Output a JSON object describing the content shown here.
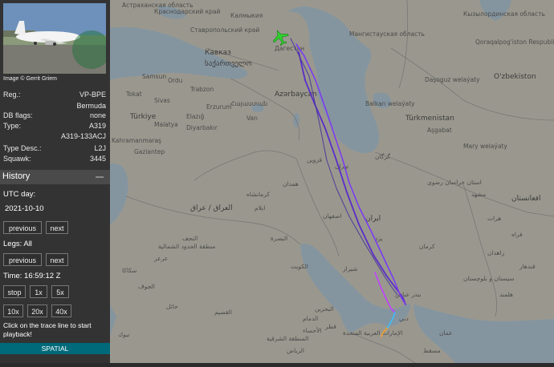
{
  "photo": {
    "credit": "Image © Gerrit Griem"
  },
  "aircraft": {
    "reg_label": "Reg.:",
    "reg_value": "VP-BPE",
    "country": "Bermuda",
    "db_flags_label": "DB flags:",
    "db_flags_value": "none",
    "type_label": "Type:",
    "type_value": "A319",
    "type_full": "A319-133ACJ",
    "type_desc_label": "Type Desc.:",
    "type_desc_value": "L2J",
    "squawk_label": "Squawk:",
    "squawk_value": "3445"
  },
  "history": {
    "title": "History",
    "utc_day_label": "UTC day:",
    "utc_day_value": "2021-10-10",
    "previous": "previous",
    "next": "next",
    "legs_label": "Legs: All",
    "legs_previous": "previous",
    "legs_next": "next",
    "time_label": "Time: 16:59:12 Z",
    "stop": "stop",
    "speed_1x": "1x",
    "speed_5x": "5x",
    "speed_10x": "10x",
    "speed_20x": "20x",
    "speed_40x": "40x",
    "help": "Click on the trace line to start playback!",
    "spatial": "SPATIAL"
  },
  "map": {
    "labels": {
      "astrakhan": "Астраханская область",
      "krasnodar": "Краснодарский край",
      "stavropol": "Ставропольский край",
      "kalmykia": "Калмыкия",
      "kyzylorda": "Кызылординская область",
      "mangystau": "Мангистауская область",
      "karakalpak": "Qoraqalpog'iston Respublikasi",
      "caucasus": "Кавказ",
      "georgia": "საქართველო",
      "dagestan": "Дагестан",
      "armenia": "Հայաստան",
      "azerbaijan": "Azərbaycan",
      "samsun": "Samsun",
      "ordu": "Ordu",
      "trabzon": "Trabzon",
      "sivas": "Sivas",
      "tokat": "Tokat",
      "erzurum": "Erzurum",
      "turkiye": "Türkiye",
      "malatya": "Malatya",
      "elazig": "Elazığ",
      "diyarbakir": "Diyarbakır",
      "kahramanmaras": "Kahramanmaraş",
      "gaziantep": "Gaziantep",
      "van": "Van",
      "balkan": "Balkan welaýaty",
      "turkmenistan": "Türkmenistan",
      "dasoguz": "Daşoguz welaýaty",
      "uzbekistan": "O'zbekiston",
      "ashgabat": "Aşgabat",
      "mary": "Mary welaýaty",
      "gorgan": "گرگان",
      "tehran": "تهران",
      "qazvin": "قزوین",
      "kermanshah": "کرمانشاه",
      "hamadan": "همدان",
      "iraq": "العراق / عراق",
      "ilam": "ایلام",
      "isfahan": "اصفهان",
      "iran": "ایران",
      "yazd": "یزد",
      "kerman": "کرمان",
      "khorasan": "استان خراسان رضوی",
      "mashhad": "مشهد",
      "sistan": "سیستان و بلوچستان",
      "afghanistan": "افغانستان",
      "herat": "هرات",
      "farah": "فراه",
      "najaf": "النجف",
      "basra": "البصرة",
      "kuwait": "الكويت",
      "hail": "حائل",
      "qassim": "القصيم",
      "riyadh": "الرياض",
      "dammam": "الدمام",
      "ahsa": "الأحساء",
      "uae": "الإمارات العربية المتحدة",
      "muscat": "مسقط",
      "shiraz": "شيراز",
      "bandar": "بندر عباس",
      "sakaka": "سكاكا",
      "arar": "عرعر",
      "tabuk": "تبوك",
      "jawf": "الجوف",
      "northern": "منطقة الحدود الشمالية",
      "eastern": "المنطقة الشرقية",
      "qatar": "قطر",
      "bahrain": "البحرين",
      "dubai": "دبي",
      "oman": "عمان",
      "zahedan": "زاهدان",
      "kandahar": "قندهار",
      "helmand": "هلمند"
    }
  },
  "colors": {
    "land": "#ccc8b7",
    "water": "#a9c4d6",
    "overlay": "rgba(80,80,80,0.42)",
    "plane": "#2ed12e"
  }
}
